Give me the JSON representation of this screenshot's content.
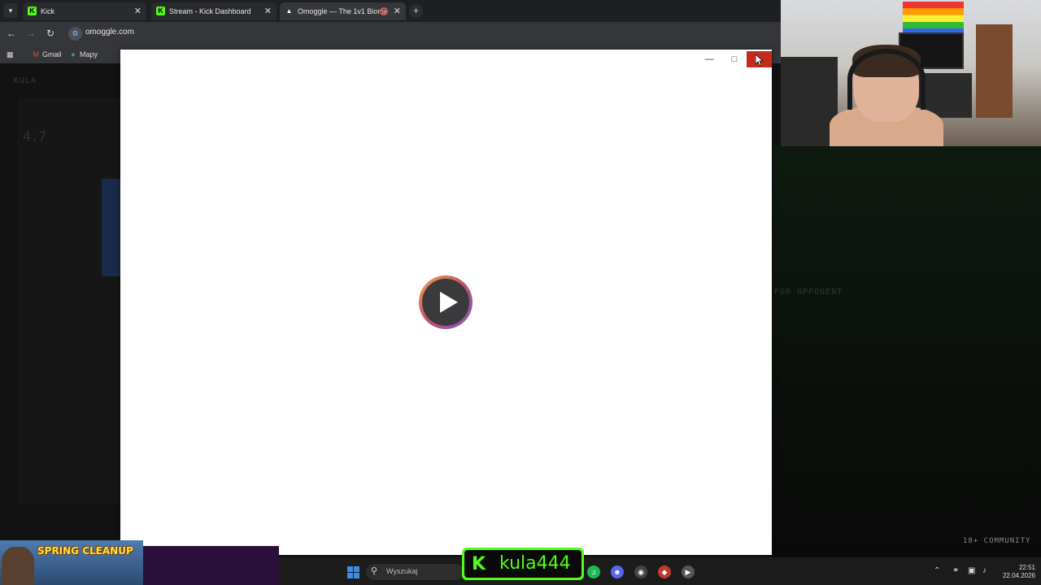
{
  "browser": {
    "tabs": [
      {
        "label": "Kick",
        "favicon": "kick-logo-icon"
      },
      {
        "label": "Stream - Kick Dashboard",
        "favicon": "kick-logo-icon"
      },
      {
        "label": "Omoggle — The 1v1 Biome",
        "favicon": "triangle-logo-icon",
        "recording": true
      }
    ],
    "new_tab_label": "+",
    "url": "omoggle.com",
    "bookmarks": [
      {
        "label": "Gmail",
        "icon": "gmail-icon"
      },
      {
        "label": "Mapy",
        "icon": "maps-pin-icon"
      }
    ]
  },
  "background_page": {
    "title": "KULA",
    "rating": "4.7",
    "opponent_text": "FOR OPPONENT",
    "community_label": "18+ COMMUNITY"
  },
  "overlay": {
    "banner_text": "SPRING CLEANUP",
    "kick_username": "kula444",
    "kick_letter": "K"
  },
  "taskbar": {
    "search_placeholder": "Wyszukaj",
    "time": "22:51",
    "date": "22.04.2026"
  },
  "colors": {
    "kick_green": "#53fc18",
    "close_red": "#c42b1c",
    "windows_blue": "#3a8ee6"
  }
}
